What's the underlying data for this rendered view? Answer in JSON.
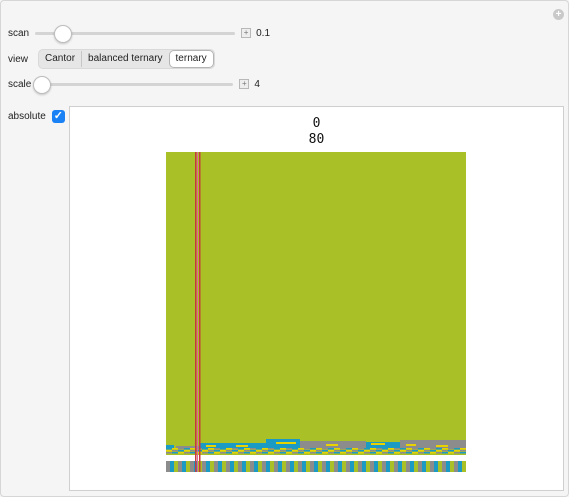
{
  "controls": {
    "scan": {
      "label": "scan",
      "value": "0.1",
      "fraction": 0.1
    },
    "view": {
      "label": "view",
      "options": [
        "Cantor",
        "balanced ternary",
        "ternary"
      ],
      "selected": "ternary"
    },
    "scale": {
      "label": "scale",
      "value": "4",
      "fraction": 0.0
    },
    "absolute": {
      "label": "absolute",
      "checked": true
    }
  },
  "plot": {
    "line1": "0",
    "line2": "80",
    "colors": {
      "main": "#a9c127",
      "blue": "#1b9bc4",
      "gray": "#8c8c8c",
      "yellow": "#e8d200",
      "red": "#c53b3b",
      "pink": "#e3669a"
    }
  }
}
